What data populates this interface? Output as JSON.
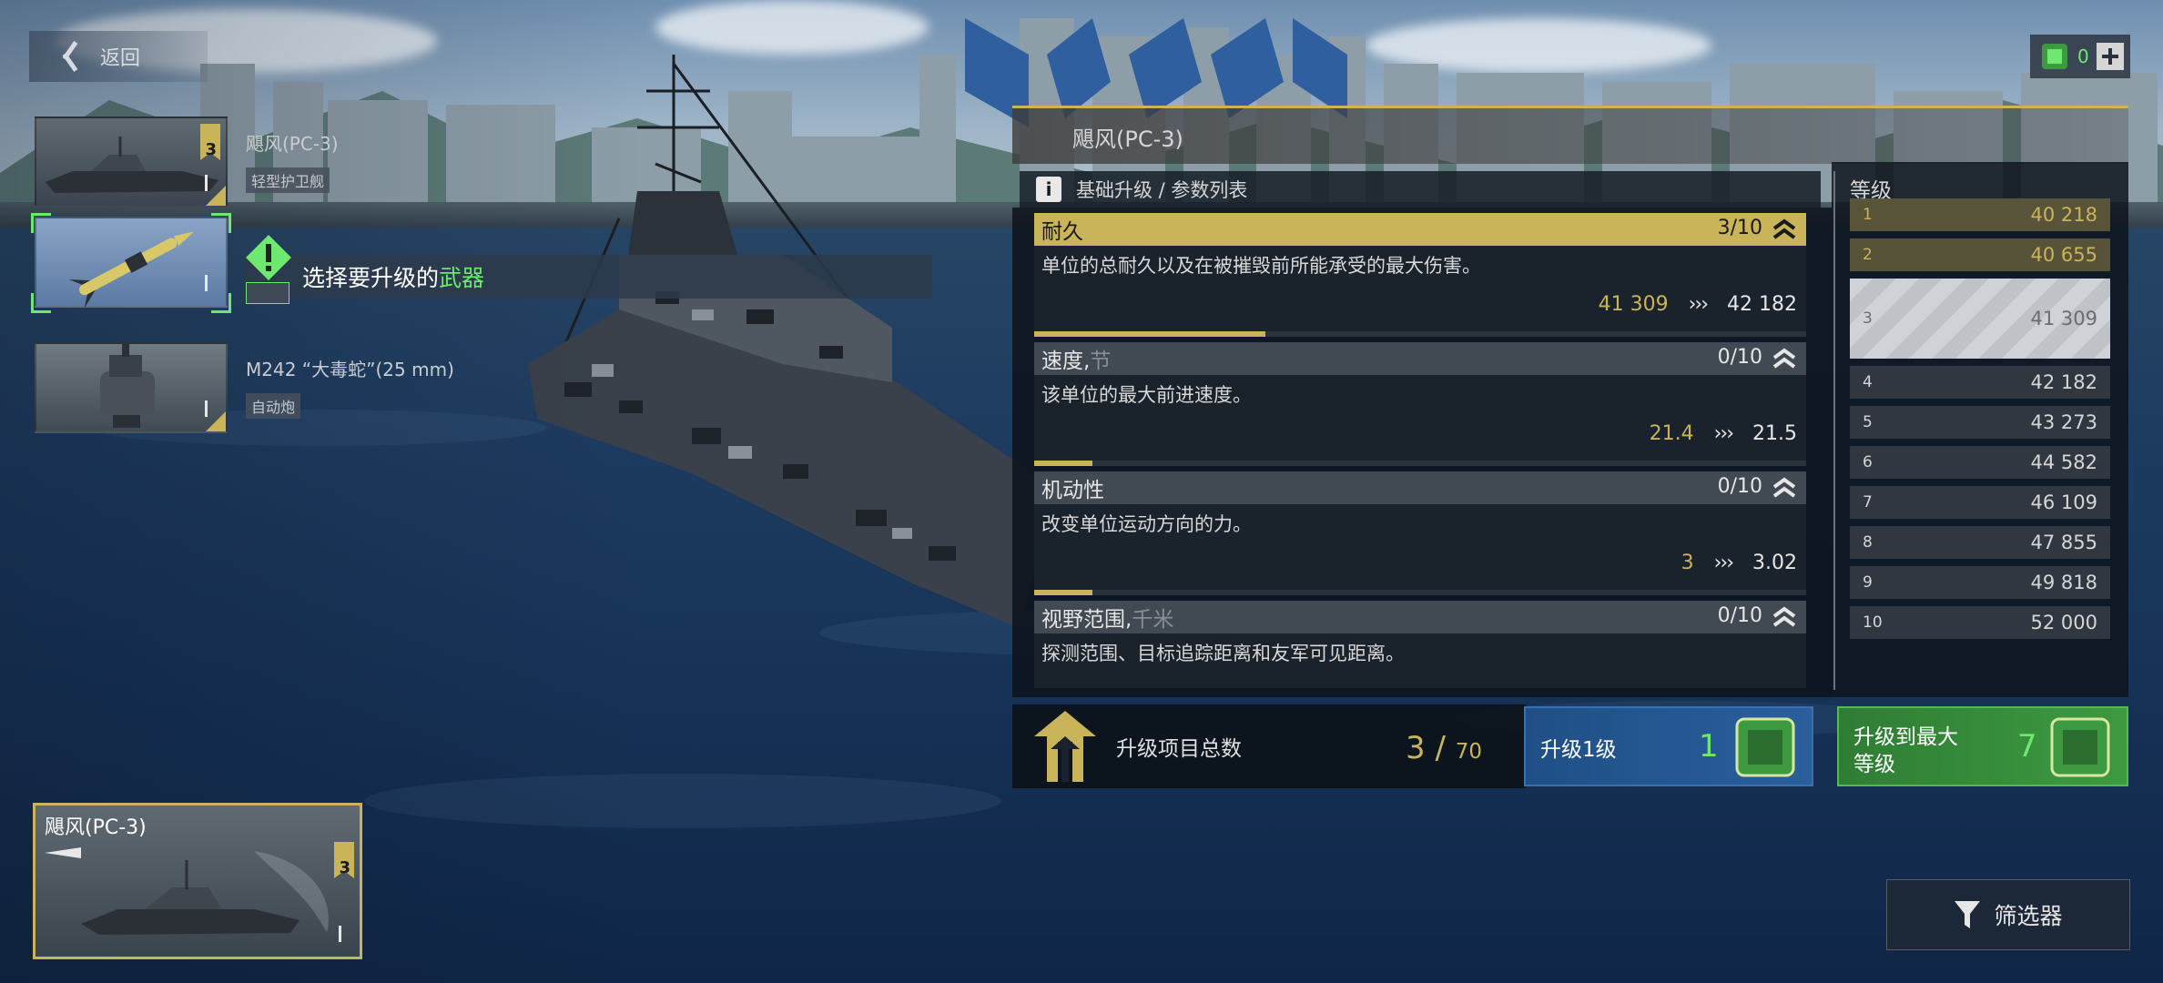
{
  "nav": {
    "back_label": "返回"
  },
  "resource": {
    "value": "0",
    "icon": "chip-currency-icon",
    "plus_icon": "plus-icon"
  },
  "weapons": [
    {
      "name": "飓风(PC-3)",
      "type": "轻型护卫舰",
      "rank": "3",
      "icon": "ship-icon"
    },
    {
      "name": "",
      "type": "",
      "rank": "",
      "icon": "missile-icon"
    },
    {
      "name": "M242 “大毒蛇”(25 mm)",
      "type": "自动炮",
      "rank": "",
      "icon": "autocannon-icon"
    }
  ],
  "hint": {
    "prefix": "选择要升级的",
    "accent": "武器",
    "icon": "warning-icon"
  },
  "ship_card": {
    "name": "飓风(PC-3)",
    "rank": "3"
  },
  "panel": {
    "title": "飓风(PC-3)",
    "subtitle": "基础升级 / 参数列表",
    "stats": [
      {
        "name": "耐久",
        "unit": "",
        "level": "3/10",
        "progress": 0.3,
        "desc": "单位的总耐久以及在被摧毁前所能承受的最大伤害。",
        "current": "41 309",
        "arrow": "›››",
        "next": "42 182",
        "active": true
      },
      {
        "name": "速度,",
        "unit": " 节",
        "level": "0/10",
        "progress": 0.075,
        "desc": "该单位的最大前进速度。",
        "current": "21.4",
        "arrow": "›››",
        "next": "21.5",
        "active": false
      },
      {
        "name": "机动性",
        "unit": "",
        "level": "0/10",
        "progress": 0.075,
        "desc": "改变单位运动方向的力。",
        "current": "3",
        "arrow": "›››",
        "next": "3.02",
        "active": false
      },
      {
        "name": "视野范围,",
        "unit": " 千米",
        "level": "0/10",
        "progress": 0,
        "desc": "探测范围、目标追踪距离和友军可见距离。",
        "current": "",
        "arrow": "",
        "next": "",
        "active": false
      }
    ],
    "levels_header": "等级",
    "levels": [
      {
        "n": "1",
        "v": "40 218",
        "state": "done"
      },
      {
        "n": "2",
        "v": "40 655",
        "state": "done"
      },
      {
        "n": "3",
        "v": "41 309",
        "state": "current"
      },
      {
        "n": "4",
        "v": "42 182",
        "state": ""
      },
      {
        "n": "5",
        "v": "43 273",
        "state": ""
      },
      {
        "n": "6",
        "v": "44 582",
        "state": ""
      },
      {
        "n": "7",
        "v": "46 109",
        "state": ""
      },
      {
        "n": "8",
        "v": "47 855",
        "state": ""
      },
      {
        "n": "9",
        "v": "49 818",
        "state": ""
      },
      {
        "n": "10",
        "v": "52 000",
        "state": ""
      }
    ],
    "total": {
      "label": "升级项目总数",
      "value": "3 /",
      "max": "70"
    },
    "upgrade_one": {
      "label": "升级1级",
      "cost": "1"
    },
    "upgrade_max": {
      "label_line1": "升级到最大",
      "label_line2": "等级",
      "cost": "7"
    }
  },
  "filter": {
    "label": "筛选器",
    "icon": "filter-icon"
  },
  "colors": {
    "gold": "#c9b45a",
    "green": "#6ee86e",
    "blue_button": "#2a5f9c",
    "green_button": "#3d9a40"
  }
}
